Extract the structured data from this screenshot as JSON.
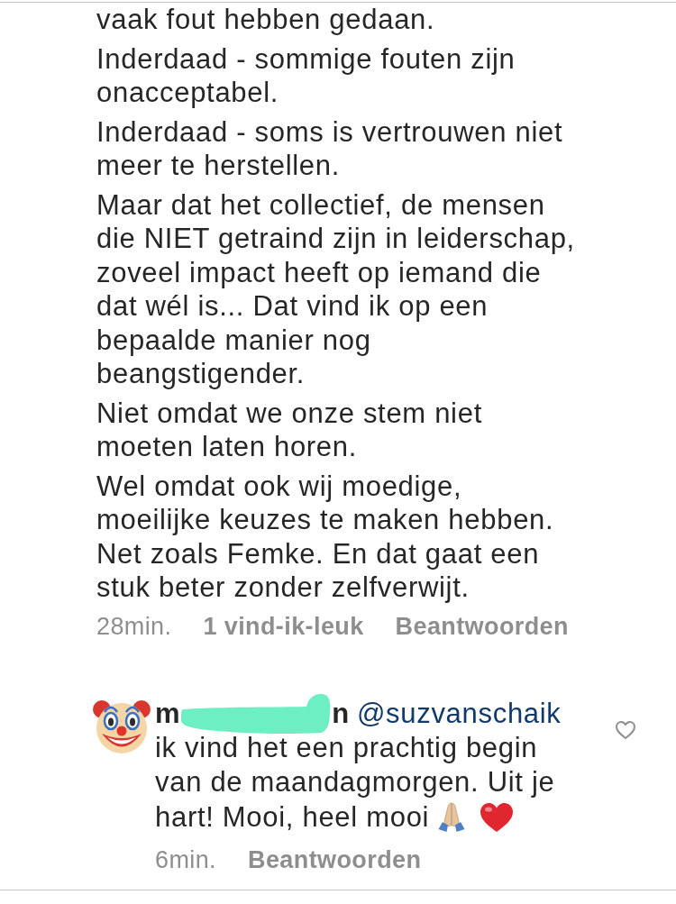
{
  "comment": {
    "paragraphs": [
      "vaak fout hebben gedaan.",
      "Inderdaad - sommige fouten zijn\nonacceptabel.",
      "Inderdaad - soms is vertrouwen niet\nmeer te herstellen.",
      "Maar dat het collectief, de mensen\ndie NIET getraind zijn in leiderschap,\nzoveel impact heeft op iemand die\ndat wél is... Dat vind ik op een\nbepaalde manier nog\nbeangstigender.",
      "Niet omdat we onze stem niet\nmoeten laten horen.",
      "Wel omdat ook wij moedige,\nmoeilijke keuzes te maken hebben.\nNet zoals Femke. En dat gaat een\nstuk beter zonder zelfverwijt."
    ],
    "time": "28min.",
    "likes": "1 vind-ik-leuk",
    "reply_action": "Beantwoorden"
  },
  "reply": {
    "author_visible_start": "m",
    "author_redacted": true,
    "author_visible_end": "n",
    "mention": "@suzvanschaik",
    "text_lines": [
      "ik vind het een prachtig begin",
      "van de maandagmorgen. Uit je",
      "hart! Mooi, heel mooi"
    ],
    "emoji": [
      {
        "kind": "pray"
      },
      {
        "kind": "heart"
      }
    ],
    "liked": false,
    "time": "6min.",
    "reply_action": "Beantwoorden"
  }
}
